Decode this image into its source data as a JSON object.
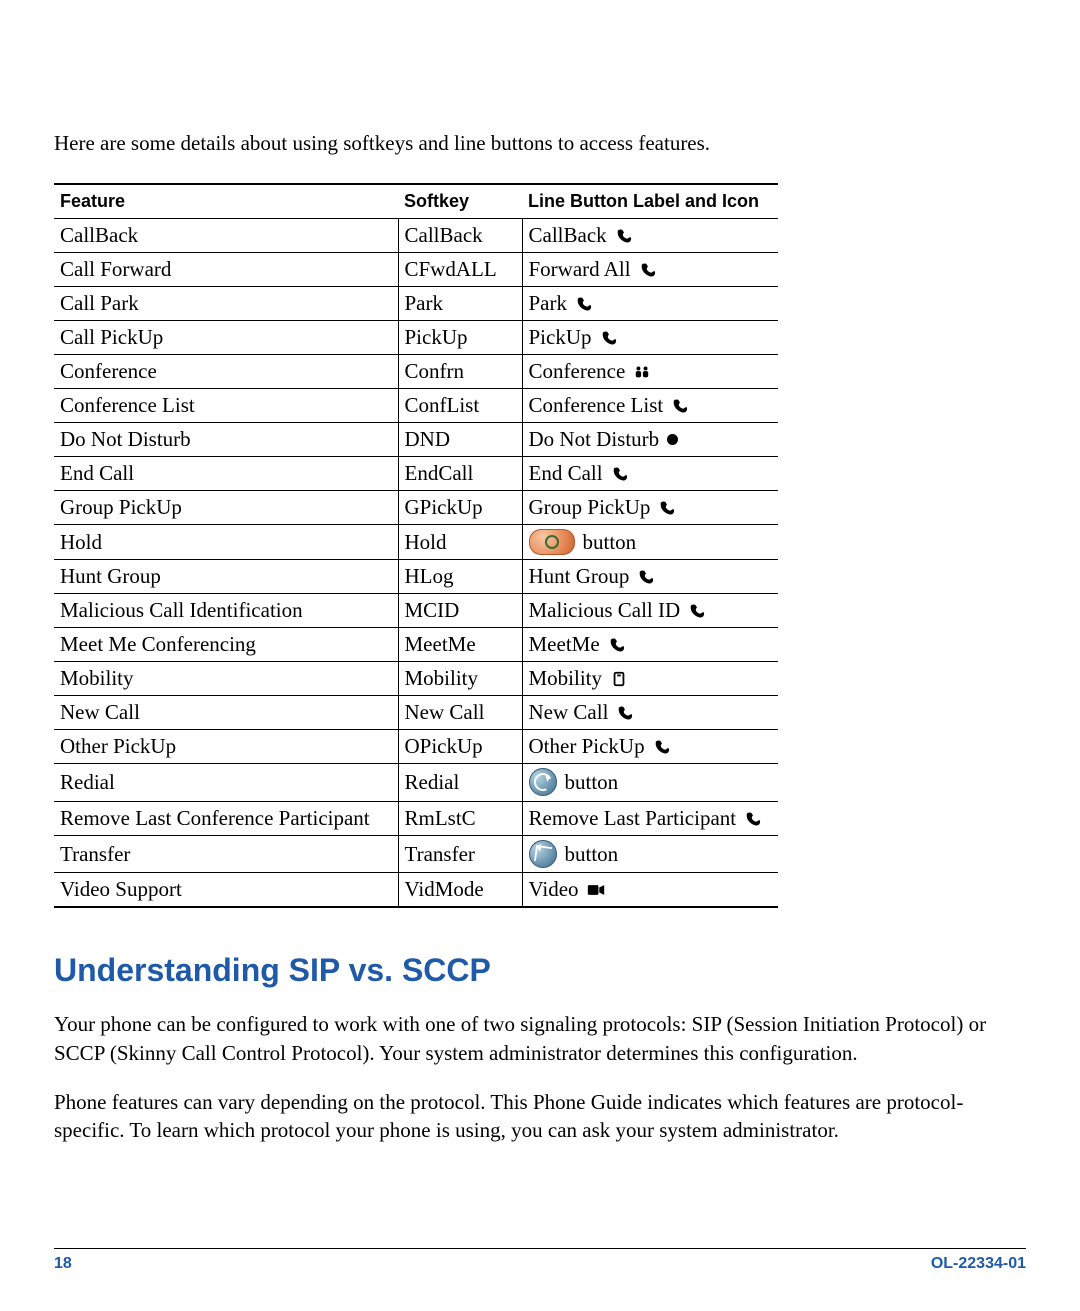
{
  "intro": "Here are some details about using softkeys and line buttons to access features.",
  "table": {
    "headers": {
      "feature": "Feature",
      "softkey": "Softkey",
      "line": "Line Button Label and Icon"
    },
    "rows": [
      {
        "feature": "CallBack",
        "softkey": "CallBack",
        "line_label": "CallBack",
        "icon": "handset"
      },
      {
        "feature": "Call Forward",
        "softkey": "CFwdALL",
        "line_label": "Forward All",
        "icon": "handset"
      },
      {
        "feature": "Call Park",
        "softkey": "Park",
        "line_label": "Park",
        "icon": "handset"
      },
      {
        "feature": "Call PickUp",
        "softkey": "PickUp",
        "line_label": "PickUp",
        "icon": "handset"
      },
      {
        "feature": "Conference",
        "softkey": "Confrn",
        "line_label": "Conference",
        "icon": "conference"
      },
      {
        "feature": "Conference List",
        "softkey": "ConfList",
        "line_label": "Conference List",
        "icon": "handset"
      },
      {
        "feature": "Do Not Disturb",
        "softkey": "DND",
        "line_label": "Do Not Disturb",
        "icon": "dot"
      },
      {
        "feature": "End Call",
        "softkey": "EndCall",
        "line_label": "End Call",
        "icon": "handset"
      },
      {
        "feature": "Group PickUp",
        "softkey": "GPickUp",
        "line_label": "Group PickUp",
        "icon": "handset"
      },
      {
        "feature": "Hold",
        "softkey": "Hold",
        "line_label": "button",
        "icon": "hold"
      },
      {
        "feature": "Hunt Group",
        "softkey": "HLog",
        "line_label": "Hunt Group",
        "icon": "handset"
      },
      {
        "feature": "Malicious Call Identification",
        "softkey": "MCID",
        "line_label": "Malicious Call ID",
        "icon": "handset"
      },
      {
        "feature": "Meet Me Conferencing",
        "softkey": "MeetMe",
        "line_label": "MeetMe",
        "icon": "handset"
      },
      {
        "feature": "Mobility",
        "softkey": "Mobility",
        "line_label": "Mobility",
        "icon": "mobility"
      },
      {
        "feature": "New Call",
        "softkey": "New Call",
        "line_label": "New Call",
        "icon": "handset"
      },
      {
        "feature": "Other PickUp",
        "softkey": "OPickUp",
        "line_label": "Other PickUp",
        "icon": "handset"
      },
      {
        "feature": "Redial",
        "softkey": "Redial",
        "line_label": "button",
        "icon": "redial"
      },
      {
        "feature": "Remove Last Conference Participant",
        "softkey": "RmLstC",
        "line_label": "Remove Last Participant",
        "icon": "handset"
      },
      {
        "feature": "Transfer",
        "softkey": "Transfer",
        "line_label": "button",
        "icon": "transfer"
      },
      {
        "feature": "Video Support",
        "softkey": "VidMode",
        "line_label": "Video",
        "icon": "video"
      }
    ]
  },
  "section_heading": "Understanding SIP vs. SCCP",
  "para1": "Your phone can be configured to work with one of two signaling protocols: SIP (Session Initiation Protocol) or SCCP (Skinny Call Control Protocol). Your system administrator determines this configuration.",
  "para2": "Phone features can vary depending on the protocol. This Phone Guide indicates which features are protocol-specific. To learn which protocol your phone is using, you can ask your system administrator.",
  "footer": {
    "page": "18",
    "docid": "OL-22334-01"
  }
}
